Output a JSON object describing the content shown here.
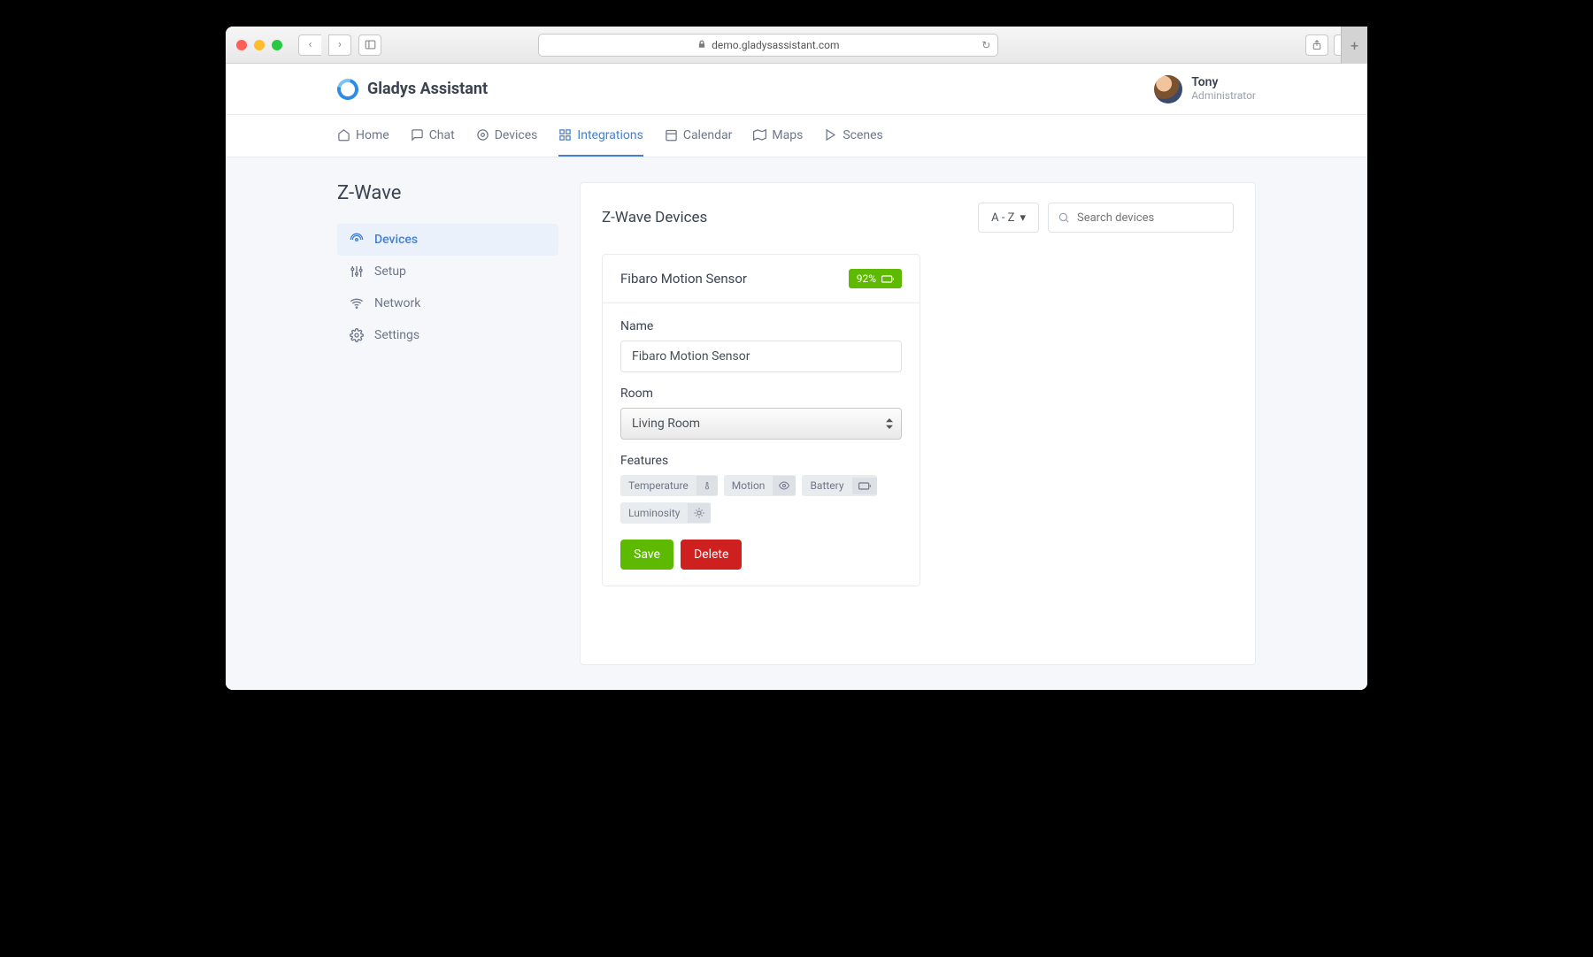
{
  "browser": {
    "url": "demo.gladysassistant.com"
  },
  "brand": "Gladys Assistant",
  "user": {
    "name": "Tony",
    "role": "Administrator"
  },
  "nav": {
    "home": "Home",
    "chat": "Chat",
    "devices": "Devices",
    "integrations": "Integrations",
    "calendar": "Calendar",
    "maps": "Maps",
    "scenes": "Scenes"
  },
  "sidebar": {
    "title": "Z-Wave",
    "items": [
      {
        "label": "Devices"
      },
      {
        "label": "Setup"
      },
      {
        "label": "Network"
      },
      {
        "label": "Settings"
      }
    ]
  },
  "main": {
    "title": "Z-Wave Devices",
    "sort": "A - Z",
    "search_placeholder": "Search devices"
  },
  "device": {
    "title": "Fibaro Motion Sensor",
    "battery": "92%",
    "name_label": "Name",
    "name_value": "Fibaro Motion Sensor",
    "room_label": "Room",
    "room_value": "Living Room",
    "features_label": "Features",
    "features": [
      {
        "label": "Temperature"
      },
      {
        "label": "Motion"
      },
      {
        "label": "Battery"
      },
      {
        "label": "Luminosity"
      }
    ],
    "save": "Save",
    "delete": "Delete"
  }
}
